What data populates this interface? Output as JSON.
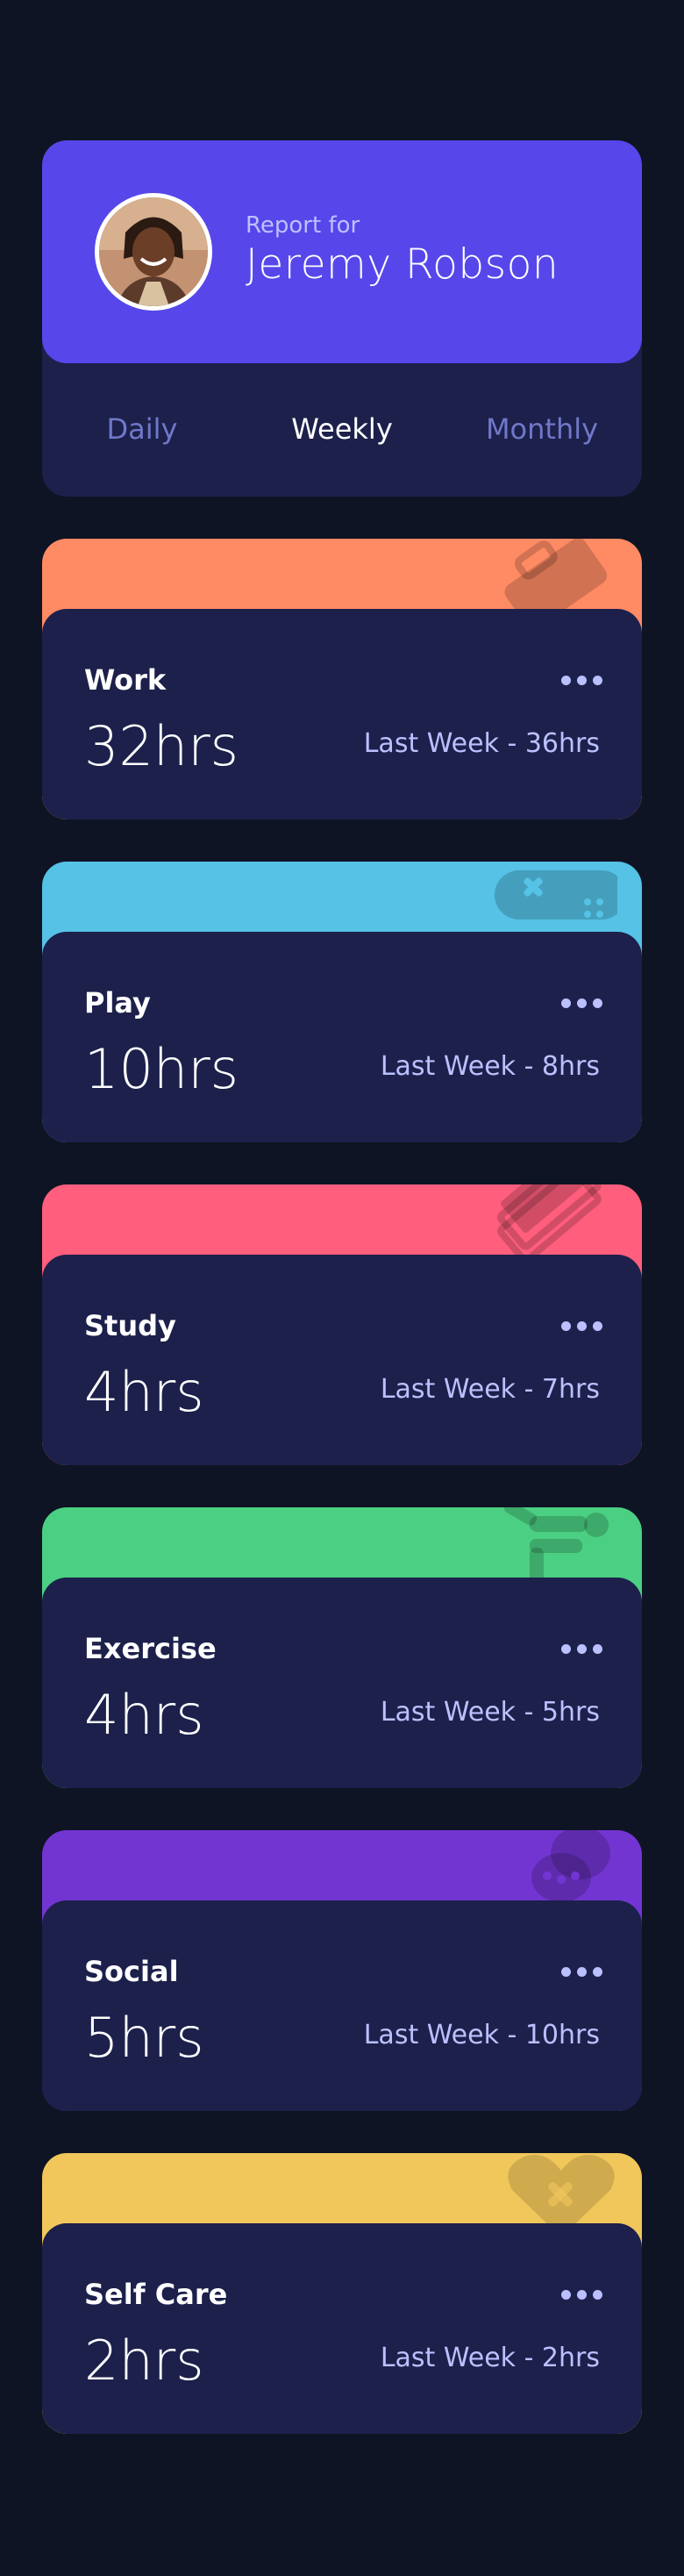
{
  "profile": {
    "report_for": "Report for",
    "name": "Jeremy Robson"
  },
  "tabs": [
    {
      "label": "Daily",
      "active": false
    },
    {
      "label": "Weekly",
      "active": true
    },
    {
      "label": "Monthly",
      "active": false
    }
  ],
  "activities": [
    {
      "title": "Work",
      "current": "32hrs",
      "previous": "Last Week - 36hrs",
      "color": "#ff8b64",
      "icon": "briefcase-icon"
    },
    {
      "title": "Play",
      "current": "10hrs",
      "previous": "Last Week - 8hrs",
      "color": "#55c2e6",
      "icon": "gamepad-icon"
    },
    {
      "title": "Study",
      "current": "4hrs",
      "previous": "Last Week - 7hrs",
      "color": "#ff5e7d",
      "icon": "book-icon"
    },
    {
      "title": "Exercise",
      "current": "4hrs",
      "previous": "Last Week - 5hrs",
      "color": "#4bcf82",
      "icon": "running-icon"
    },
    {
      "title": "Social",
      "current": "5hrs",
      "previous": "Last Week - 10hrs",
      "color": "#7335d2",
      "icon": "chat-icon"
    },
    {
      "title": "Self Care",
      "current": "2hrs",
      "previous": "Last Week - 2hrs",
      "color": "#f1c75b",
      "icon": "heart-icon"
    }
  ],
  "colors": {
    "background": "#0f1424",
    "card": "#1c204b",
    "profile": "#5747ea",
    "muted": "#bbc0ff",
    "tab_inactive": "#7078c9"
  }
}
